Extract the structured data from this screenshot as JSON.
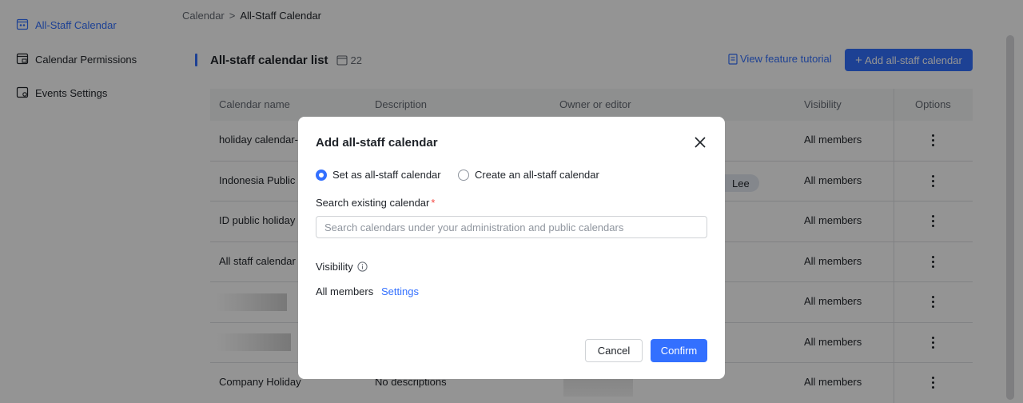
{
  "sidebar": {
    "items": [
      {
        "label": "All-Staff Calendar",
        "icon": "calendar-users-icon",
        "active": true
      },
      {
        "label": "Calendar Permissions",
        "icon": "calendar-lock-icon",
        "active": false
      },
      {
        "label": "Events Settings",
        "icon": "calendar-gear-icon",
        "active": false
      }
    ]
  },
  "breadcrumb": {
    "root": "Calendar",
    "separator": ">",
    "current": "All-Staff Calendar"
  },
  "list": {
    "title": "All-staff calendar list",
    "count": "22",
    "tutorial_link": "View feature tutorial",
    "add_button": "Add all-staff calendar"
  },
  "table": {
    "columns": [
      "Calendar name",
      "Description",
      "Owner or editor",
      "Visibility",
      "Options"
    ],
    "rows": [
      {
        "name": "holiday calendar-",
        "description": "",
        "owner": "",
        "visibility": "All members"
      },
      {
        "name": "Indonesia Public I",
        "description": "",
        "owner": "Lee",
        "visibility": "All members"
      },
      {
        "name": "ID public holiday",
        "description": "",
        "owner": "",
        "visibility": "All members"
      },
      {
        "name": "All staff calendar",
        "description": "",
        "owner": "",
        "visibility": "All members"
      },
      {
        "name": "",
        "description": "",
        "owner": "",
        "visibility": "All members"
      },
      {
        "name": "",
        "description": "",
        "owner": "",
        "visibility": "All members"
      },
      {
        "name": "Company Holiday",
        "description": "No descriptions",
        "owner": "",
        "visibility": "All members"
      }
    ]
  },
  "modal": {
    "title": "Add all-staff calendar",
    "radio_options": [
      "Set as all-staff calendar",
      "Create an all-staff calendar"
    ],
    "selected_option": "Set as all-staff calendar",
    "search_label": "Search existing calendar",
    "required_mark": "*",
    "search_placeholder": "Search calendars under your administration and public calendars",
    "search_value": "",
    "visibility_label": "Visibility",
    "visibility_value": "All members",
    "settings_link": "Settings",
    "cancel_button": "Cancel",
    "confirm_button": "Confirm"
  },
  "colors": {
    "accent": "#3370ff",
    "required": "#f54a45",
    "overlay": "rgba(0,0,0,0.42)"
  }
}
